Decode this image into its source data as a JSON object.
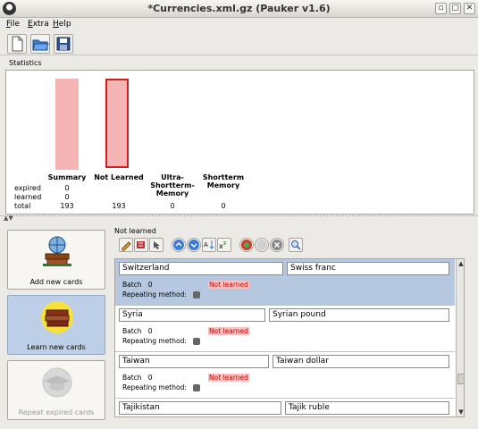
{
  "window": {
    "title": "*Currencies.xml.gz (Pauker v1.6)",
    "buttons": [
      "▫",
      "▢",
      "✕"
    ]
  },
  "menu": [
    {
      "label": "File",
      "u": "F",
      "rest": "ile"
    },
    {
      "label": "Extra",
      "u": "E",
      "rest": "xtra"
    },
    {
      "label": "Help",
      "u": "H",
      "rest": "elp"
    }
  ],
  "toolbar": {
    "icons": [
      "new-document-icon",
      "open-folder-icon",
      "save-disk-icon"
    ]
  },
  "stats": {
    "label": "Statistics",
    "rows": {
      "expired": "expired",
      "learned": "learned",
      "total": "total"
    },
    "columns": [
      {
        "name": "Summary",
        "expired": "0",
        "learned": "0",
        "total": "193"
      },
      {
        "name": "Not Learned",
        "expired": "",
        "learned": "",
        "total": "193"
      },
      {
        "name": "Ultra-\nShortterm-\nMemory",
        "expired": "",
        "learned": "",
        "total": "0"
      },
      {
        "name": "Shortterm\nMemory",
        "expired": "",
        "learned": "",
        "total": "0"
      }
    ]
  },
  "sidebar": [
    {
      "label": "Add new cards",
      "icon": "globe-books-icon"
    },
    {
      "label": "Learn new cards",
      "icon": "book-stack-icon"
    },
    {
      "label": "Repeat expired cards",
      "icon": "graduation-cap-icon"
    }
  ],
  "cards_panel": {
    "label": "Not learned",
    "tool_icons": [
      "edit-icon",
      "instant-repeat-icon",
      "move-back-icon",
      "up-arrow-icon",
      "down-arrow-icon",
      "sort-icon",
      "font-icon",
      "help-icon",
      "empty-icon",
      "delete-icon",
      "search-icon"
    ],
    "batch_label": "Batch",
    "repeat_label": "Repeating method:",
    "status": "Not learned",
    "cards": [
      {
        "front": "Switzerland",
        "back": "Swiss franc",
        "batch": "0",
        "selected": true
      },
      {
        "front": "Syria",
        "back": "Syrian pound",
        "batch": "0",
        "selected": false
      },
      {
        "front": "Taiwan",
        "back": "Taiwan dollar",
        "batch": "0",
        "selected": false
      },
      {
        "front": "Tajikistan",
        "back": "Tajik ruble",
        "batch": "",
        "selected": false
      }
    ]
  },
  "colors": {
    "bar": "#f6b5b5",
    "bar_border": "#d01e1e",
    "selection": "#b6c8e0",
    "not_learned": "#c00"
  }
}
